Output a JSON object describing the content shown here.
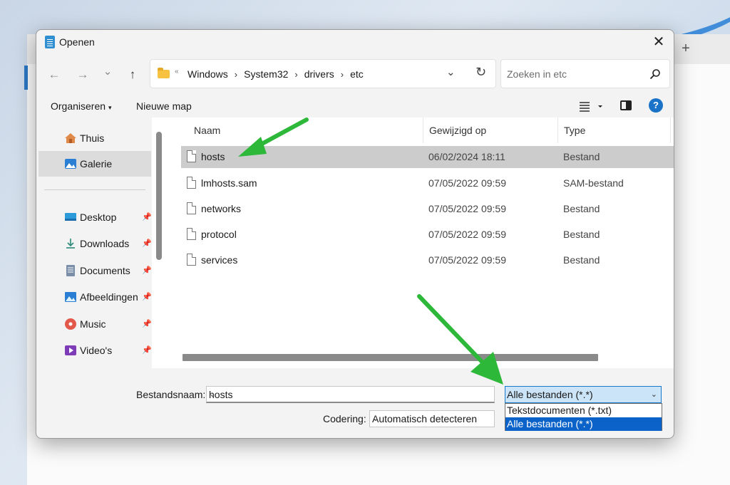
{
  "dialog": {
    "title": "Openen",
    "close_glyph": "✕"
  },
  "nav": {
    "back_glyph": "←",
    "forward_glyph": "→",
    "recent_glyph": "⌄",
    "up_glyph": "↑"
  },
  "address": {
    "crumbs": [
      "Windows",
      "System32",
      "drivers",
      "etc"
    ],
    "separator": "›",
    "dropdown_glyph": "⌄",
    "refresh_glyph": "↻"
  },
  "search": {
    "placeholder": "Zoeken in etc"
  },
  "commands": {
    "organize": "Organiseren",
    "new_folder": "Nieuwe map",
    "help": "?"
  },
  "sidebar": {
    "items": [
      {
        "label": "Thuis",
        "icon": "home-icon",
        "pinned": false
      },
      {
        "label": "Galerie",
        "icon": "gallery-icon",
        "pinned": false
      },
      {
        "label": "Desktop",
        "icon": "desktop-icon",
        "pinned": true
      },
      {
        "label": "Downloads",
        "icon": "download-icon",
        "pinned": true
      },
      {
        "label": "Documents",
        "icon": "documents-icon",
        "pinned": true
      },
      {
        "label": "Afbeeldingen",
        "icon": "pictures-icon",
        "pinned": true
      },
      {
        "label": "Music",
        "icon": "music-icon",
        "pinned": true
      },
      {
        "label": "Video's",
        "icon": "video-icon",
        "pinned": true
      }
    ],
    "pin_glyph": "📌"
  },
  "files": {
    "columns": [
      "Naam",
      "Gewijzigd op",
      "Type"
    ],
    "rows": [
      {
        "name": "hosts",
        "modified": "06/02/2024 18:11",
        "type": "Bestand"
      },
      {
        "name": "lmhosts.sam",
        "modified": "07/05/2022 09:59",
        "type": "SAM-bestand"
      },
      {
        "name": "networks",
        "modified": "07/05/2022 09:59",
        "type": "Bestand"
      },
      {
        "name": "protocol",
        "modified": "07/05/2022 09:59",
        "type": "Bestand"
      },
      {
        "name": "services",
        "modified": "07/05/2022 09:59",
        "type": "Bestand"
      }
    ]
  },
  "bottom": {
    "filename_label": "Bestandsnaam:",
    "filename_value": "hosts",
    "encoding_label": "Codering:",
    "encoding_value": "Automatisch detecteren",
    "filter_value": "Alle bestanden  (*.*)",
    "filter_options": [
      "Tekstdocumenten (*.txt)",
      "Alle bestanden  (*.*)"
    ]
  },
  "colors": {
    "accent": "#1979ca",
    "selection": "#0b63c9",
    "annotation_arrow": "#2db83a"
  }
}
